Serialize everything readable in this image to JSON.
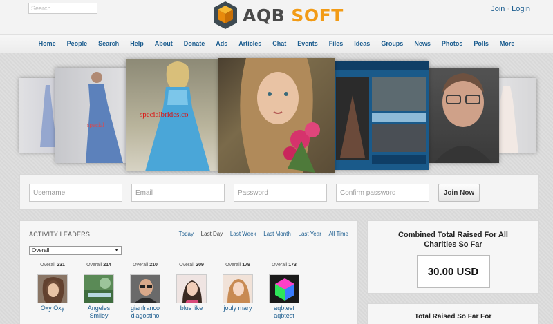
{
  "header": {
    "search_placeholder": "Search...",
    "logo_text_a": "AQB",
    "logo_text_b": "SOFT",
    "join_link": "Join",
    "login_link": "Login"
  },
  "nav": {
    "items": [
      "Home",
      "People",
      "Search",
      "Help",
      "About",
      "Donate",
      "Ads",
      "Articles",
      "Chat",
      "Events",
      "Files",
      "Ideas",
      "Groups",
      "News",
      "Photos",
      "Polls",
      "More"
    ]
  },
  "carousel": {
    "watermark": "specialbrides.co"
  },
  "signup": {
    "username_placeholder": "Username",
    "email_placeholder": "Email",
    "password_placeholder": "Password",
    "confirm_placeholder": "Confirm password",
    "join_button": "Join Now"
  },
  "activity": {
    "title": "ACTIVITY LEADERS",
    "filters": [
      "Today",
      "Last Day",
      "Last Week",
      "Last Month",
      "Last Year",
      "All Time"
    ],
    "selected_filter": "Last Day",
    "selected_option": "Overall",
    "leaders": [
      {
        "label": "Overall",
        "score": "231",
        "name_1": "Oxy Oxy",
        "name_2": ""
      },
      {
        "label": "Overall",
        "score": "214",
        "name_1": "Angeles",
        "name_2": "Smiley"
      },
      {
        "label": "Overall",
        "score": "210",
        "name_1": "gianfranco",
        "name_2": "d'agostino"
      },
      {
        "label": "Overall",
        "score": "209",
        "name_1": "blus like",
        "name_2": ""
      },
      {
        "label": "Overall",
        "score": "179",
        "name_1": "jouly mary",
        "name_2": ""
      },
      {
        "label": "Overall",
        "score": "173",
        "name_1": "aqbtest",
        "name_2": "aqbtest"
      }
    ]
  },
  "charity": {
    "combined_title": "Combined Total Raised For All Charities So Far",
    "combined_amount": "30.00 USD",
    "second_title": "Total Raised So Far For"
  },
  "colors": {
    "link": "#1c5d8f",
    "brand_orange": "#f29b16",
    "brand_dark": "#4a4a4a"
  }
}
